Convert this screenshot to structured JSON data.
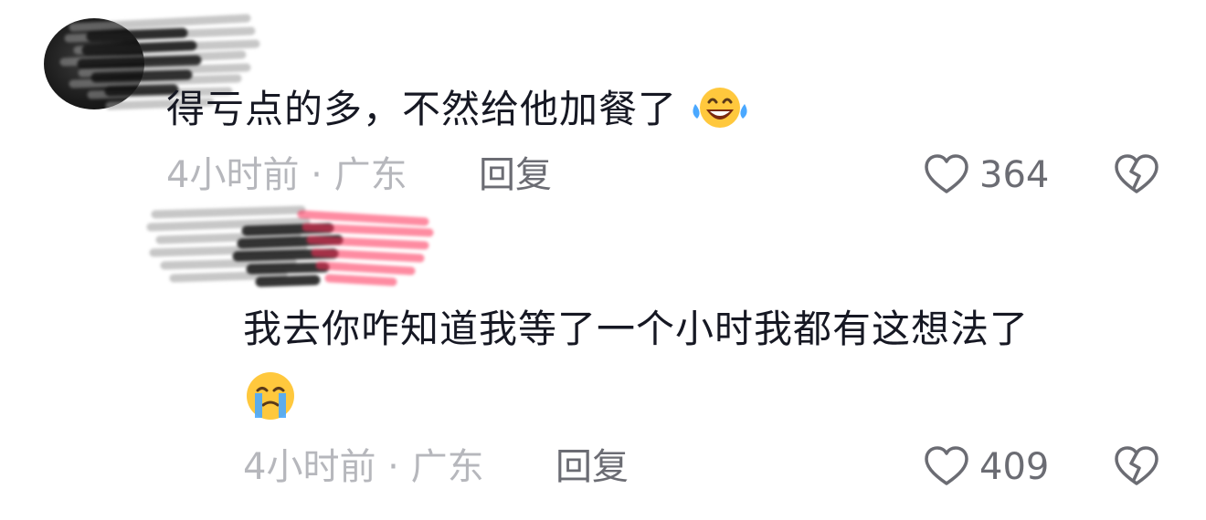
{
  "comment": {
    "text": "得亏点的多，不然给他加餐了",
    "emoji": "laughing-with-tears-emoji",
    "time": "4小时前",
    "separator": "·",
    "location": "广东",
    "reply_label": "回复",
    "like_count": "364"
  },
  "reply": {
    "text": "我去你咋知道我等了一个小时我都有这想法了",
    "emoji": "crying-face-emoji",
    "time": "4小时前",
    "separator": "·",
    "location": "广东",
    "reply_label": "回复",
    "like_count": "409"
  },
  "colors": {
    "text": "#161823",
    "meta": "#b6b7bc",
    "action": "#6b6c73",
    "emoji_yellow": "#ffc83d",
    "tear_blue": "#4aa8ff",
    "author_badge": "#fe2c55"
  }
}
